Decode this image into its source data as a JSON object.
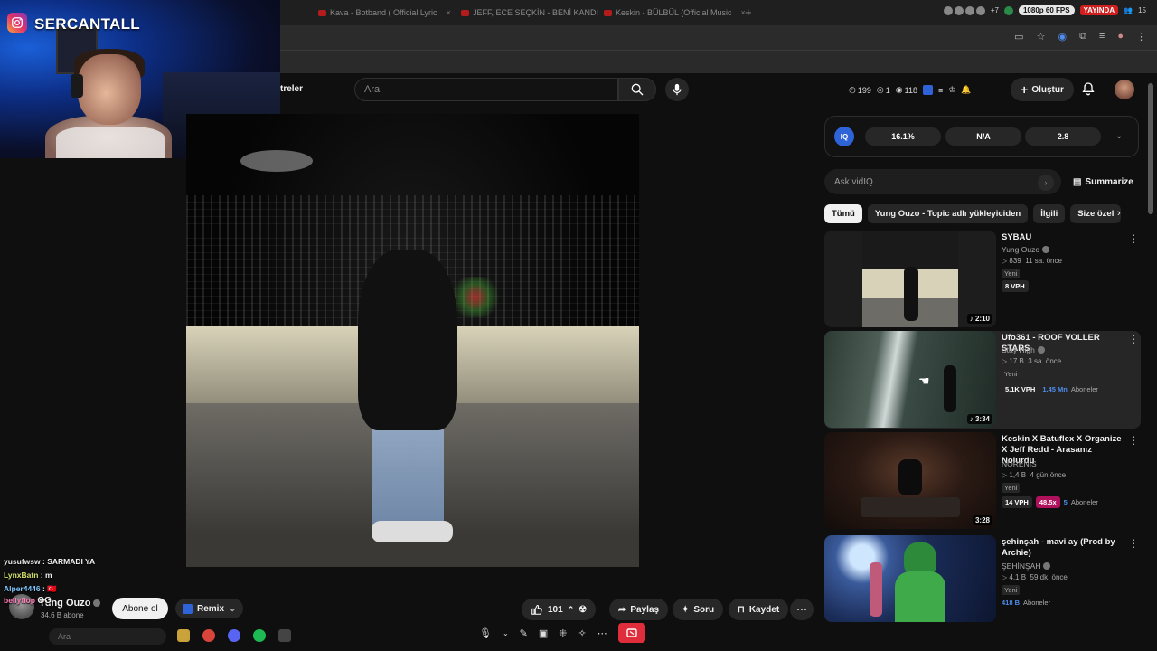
{
  "browser": {
    "tabs": [
      {
        "label": "Kava - Botband ( Official Lyric"
      },
      {
        "label": "JEFF, ECE SEÇKİN - BENİ KANDI"
      },
      {
        "label": "Keskin - BÜLBÜL (Official Music"
      }
    ],
    "new_tab": "+",
    "ext_count": "+7",
    "fps_badge": "1080p 60 FPS",
    "live_badge": "YAYINDA",
    "viewer_count": "15"
  },
  "webcam": {
    "streamer_name": "SERCANTALL"
  },
  "masthead": {
    "filters_label": "treler",
    "search_placeholder": "Ara",
    "stat_1": "199",
    "stat_2": "1",
    "stat_3": "118",
    "create_label": "Oluştur"
  },
  "vidiq": {
    "logo": "IQ",
    "metrics": [
      "16.1%",
      "N/A",
      "2.8"
    ],
    "ask_placeholder": "Ask vidIQ",
    "summarize_label": "Summarize"
  },
  "chips": [
    "Tümü",
    "Yung Ouzo - Topic adlı yükleyiciden",
    "İlgili",
    "Size özel"
  ],
  "recommendations": [
    {
      "title": "SYBAU",
      "channel": "Yung Ouzo",
      "views": "839",
      "age": "11 sa. önce",
      "badge": "Yeni",
      "vph": "8 VPH",
      "duration": "2:10"
    },
    {
      "title": "Ufo361 - ROOF VOLLER STARS",
      "channel": "Stay High",
      "views": "17 B",
      "age": "3 sa. önce",
      "badge": "Yeni",
      "vph": "5.1K VPH",
      "subs_value": "1.45 Mn",
      "subs_label": "Aboneler",
      "duration": "3:34"
    },
    {
      "title": "Keskin X Batuflex X Organize X Jeff Redd - Arasanız Nolurdu",
      "channel": "NORENIS",
      "views": "1,4 B",
      "age": "4 gün önce",
      "badge": "Yeni",
      "vph": "14 VPH",
      "multiplier": "48.5x",
      "subs_value": "5",
      "subs_label": "Aboneler",
      "duration": "3:28"
    },
    {
      "title": "şehinşah - mavi ay (Prod by Archie)",
      "channel": "ŞEHİNŞAH",
      "views": "4,1 B",
      "age": "59 dk. önce",
      "badge": "Yeni",
      "subs_value": "418 B",
      "subs_label": "Aboneler"
    }
  ],
  "channel": {
    "name": "Yung Ouzo",
    "subscribers": "34,6 B abone",
    "subscribe_label": "Abone ol",
    "remix_label": "Remix"
  },
  "actions": {
    "likes": "101",
    "share": "Paylaş",
    "ask": "Soru",
    "save": "Kaydet"
  },
  "chat": [
    {
      "user": "yusufwsw",
      "msg": "SARMADI YA"
    },
    {
      "user": "LynxBatn",
      "msg": "m"
    },
    {
      "user": "Alper4446",
      "msg": "🇹🇷"
    },
    {
      "user": "bellyflop",
      "msg": "GG"
    }
  ],
  "taskbar": {
    "search_placeholder": "Ara"
  }
}
